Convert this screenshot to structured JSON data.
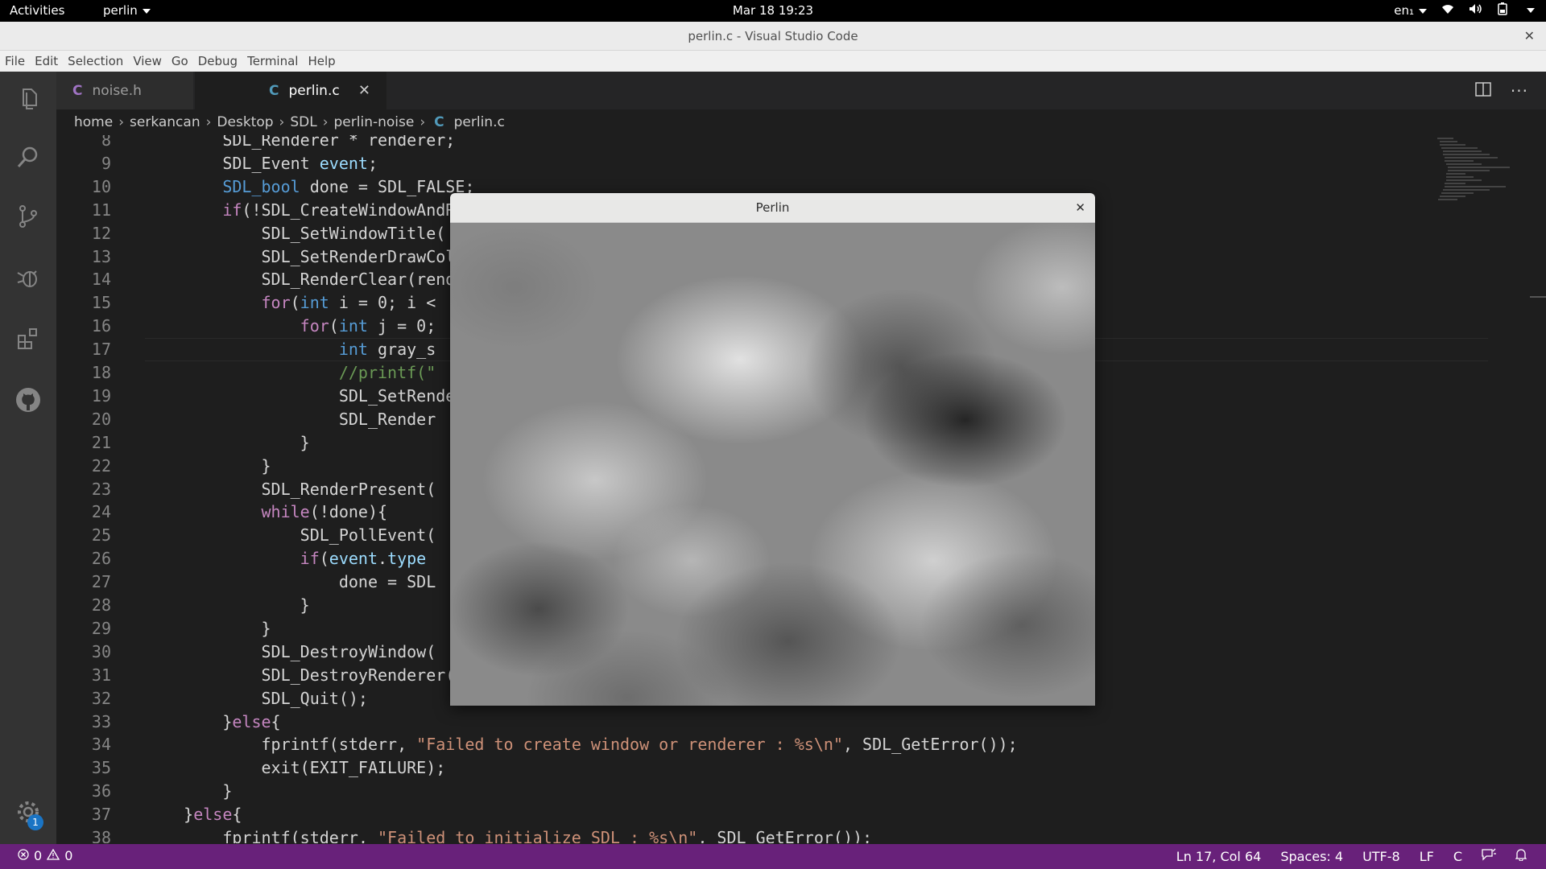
{
  "topbar": {
    "activities": "Activities",
    "app": "perlin",
    "clock": "Mar 18  19:23",
    "lang": "en₁"
  },
  "window": {
    "title": "perlin.c - Visual Studio Code"
  },
  "menu": [
    "File",
    "Edit",
    "Selection",
    "View",
    "Go",
    "Debug",
    "Terminal",
    "Help"
  ],
  "tabs": [
    {
      "icon": "C",
      "label": "noise.h"
    },
    {
      "icon": "C",
      "label": "perlin.c"
    }
  ],
  "breadcrumb": [
    "home",
    "serkancan",
    "Desktop",
    "SDL",
    "perlin-noise",
    "perlin.c"
  ],
  "breadcrumb_icon": "C",
  "settings_badge": "1",
  "editor_lines": [
    {
      "n": "8",
      "code": "        SDL_Renderer * renderer;"
    },
    {
      "n": "9",
      "code": "        SDL_Event event;"
    },
    {
      "n": "10",
      "code": "        SDL_bool done = SDL_FALSE;"
    },
    {
      "n": "11",
      "code": "        if(!SDL_CreateWindowAndRenderer("
    },
    {
      "n": "12",
      "code": "            SDL_SetWindowTitle("
    },
    {
      "n": "13",
      "code": "            SDL_SetRenderDrawColor("
    },
    {
      "n": "14",
      "code": "            SDL_RenderClear(renderer);"
    },
    {
      "n": "15",
      "code": "            for(int i = 0; i <"
    },
    {
      "n": "16",
      "code": "                for(int j = 0;"
    },
    {
      "n": "17",
      "code": "                    int gray_s"
    },
    {
      "n": "18",
      "code": "                    //printf(\""
    },
    {
      "n": "19",
      "code": "                    SDL_SetRenderDrawColor(                              L_ALPHA_OPAQUE);"
    },
    {
      "n": "20",
      "code": "                    SDL_Render"
    },
    {
      "n": "21",
      "code": "                }"
    },
    {
      "n": "22",
      "code": "            }"
    },
    {
      "n": "23",
      "code": "            SDL_RenderPresent("
    },
    {
      "n": "24",
      "code": "            while(!done){"
    },
    {
      "n": "25",
      "code": "                SDL_PollEvent("
    },
    {
      "n": "26",
      "code": "                if(event.type"
    },
    {
      "n": "27",
      "code": "                    done = SDL"
    },
    {
      "n": "28",
      "code": "                }"
    },
    {
      "n": "29",
      "code": "            }"
    },
    {
      "n": "30",
      "code": "            SDL_DestroyWindow("
    },
    {
      "n": "31",
      "code": "            SDL_DestroyRenderer("
    },
    {
      "n": "32",
      "code": "            SDL_Quit();"
    },
    {
      "n": "33",
      "code": "        }else{"
    },
    {
      "n": "34",
      "code": "            fprintf(stderr, \"Failed to create window or renderer : %s\\n\", SDL_GetError());"
    },
    {
      "n": "35",
      "code": "            exit(EXIT_FAILURE);"
    },
    {
      "n": "36",
      "code": "        }"
    },
    {
      "n": "37",
      "code": "    }else{"
    },
    {
      "n": "38",
      "code": "        fprintf(stderr, \"Failed to initialize SDL : %s\\n\", SDL_GetError());"
    }
  ],
  "perlin_window": {
    "title": "Perlin"
  },
  "status": {
    "errors": "0",
    "warnings": "0",
    "position": "Ln 17, Col 64",
    "spaces": "Spaces: 4",
    "encoding": "UTF-8",
    "eol": "LF",
    "language": "C"
  },
  "colors": {
    "statusbar": "#68217a",
    "activitybar": "#333333",
    "editor_bg": "#1e1e1e"
  }
}
